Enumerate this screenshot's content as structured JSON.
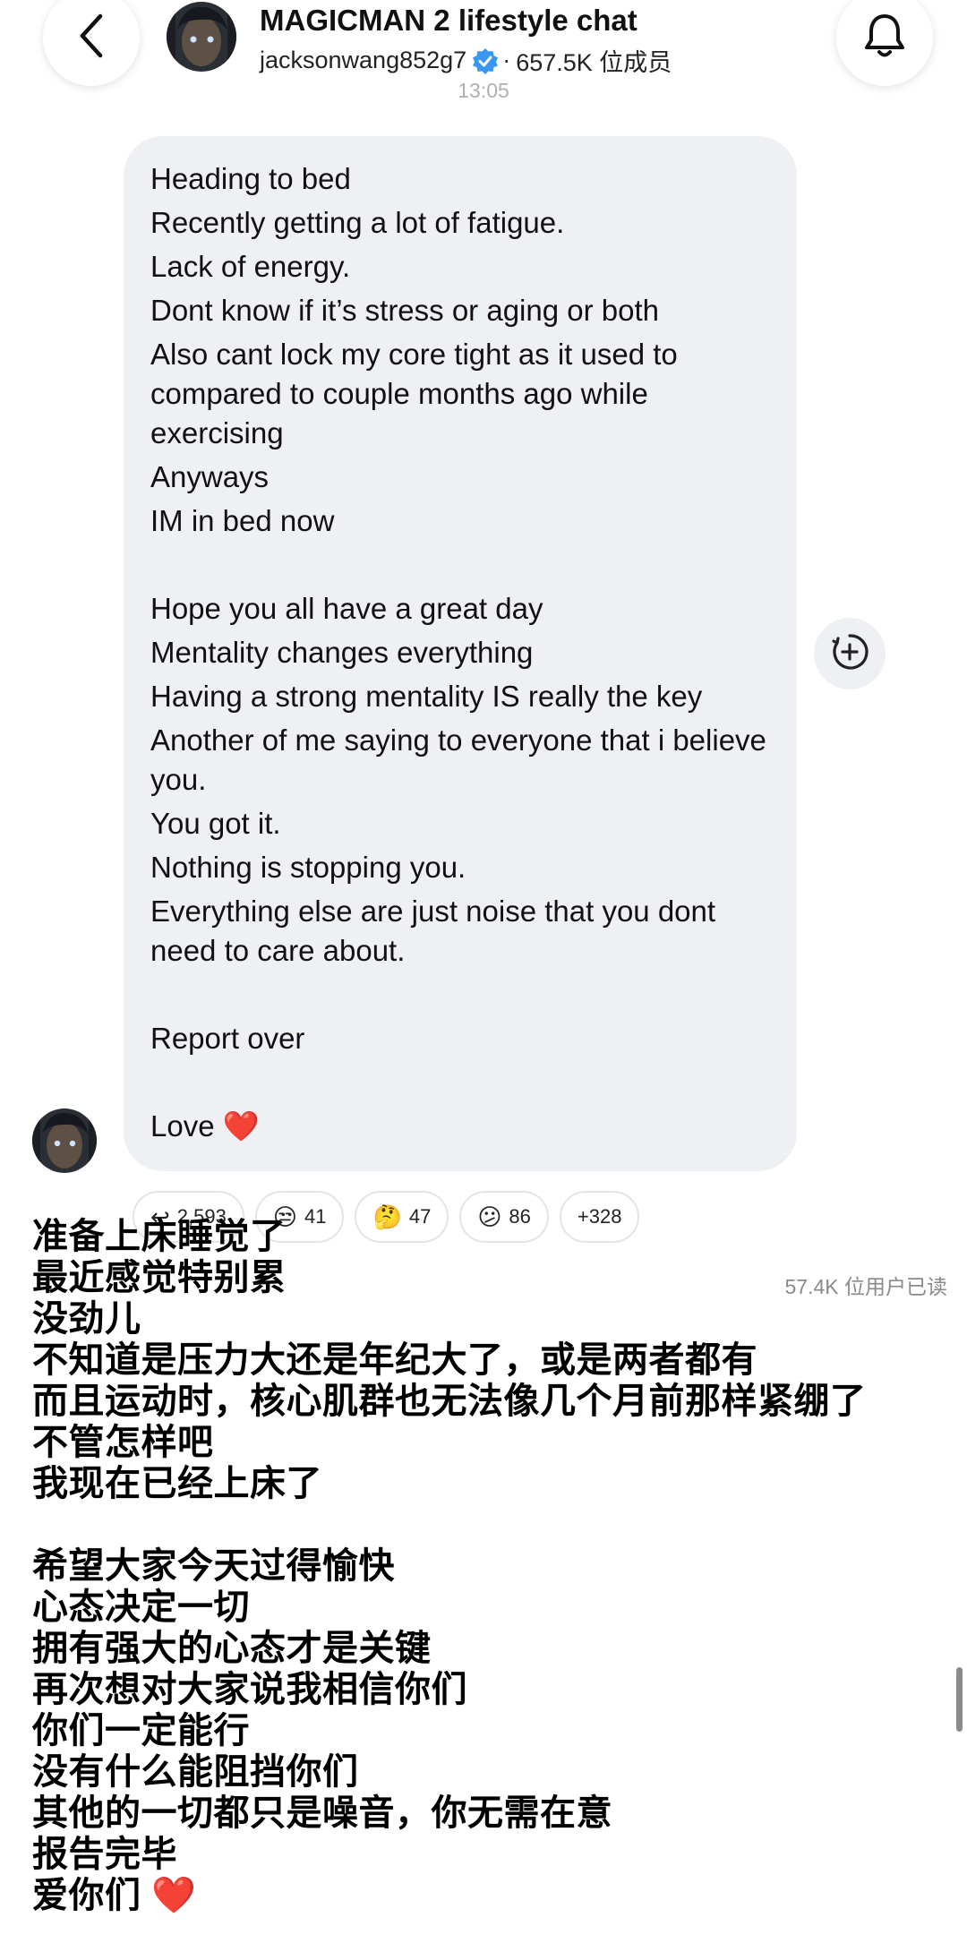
{
  "header": {
    "title": "MAGICMAN 2 lifestyle chat",
    "username": "jacksonwang852g7",
    "separator": "·",
    "members": "657.5K 位成员",
    "timestamp": "13:05"
  },
  "message": {
    "lines": [
      "Heading to bed",
      "Recently getting a lot of fatigue.",
      "Lack of energy.",
      "Dont know if it’s stress or aging or both",
      "Also cant lock my core tight as it used to compared to couple months ago while exercising",
      "Anyways",
      "IM in bed now",
      "",
      "Hope you all have a great day",
      "Mentality changes everything",
      "Having a strong mentality IS really the key",
      "Another of me saying to everyone that i believe you.",
      "You got it.",
      "Nothing is stopping you.",
      "Everything else are just noise that you dont need to care about.",
      "",
      "Report over",
      "",
      "Love ❤️"
    ]
  },
  "reactions": [
    {
      "icon": "reply-icon",
      "emoji": "↩",
      "count": "2,593"
    },
    {
      "icon": "unamused-face-icon",
      "emoji": "😒",
      "count": "41"
    },
    {
      "icon": "thinking-face-icon",
      "emoji": "🤔",
      "count": "47"
    },
    {
      "icon": "confused-face-icon",
      "emoji": "😕",
      "count": "86"
    },
    {
      "icon": "more-reactions",
      "emoji": "",
      "count": "+328"
    }
  ],
  "read_count": "57.4K 位用户已读",
  "translation": {
    "lines": [
      "准备上床睡觉了",
      "最近感觉特别累",
      "没劲儿",
      "不知道是压力大还是年纪大了，或是两者都有",
      "而且运动时，核心肌群也无法像几个月前那样紧绷了",
      "不管怎样吧",
      "我现在已经上床了",
      "",
      "希望大家今天过得愉快",
      "心态决定一切",
      "拥有强大的心态才是关键",
      "再次想对大家说我相信你们",
      "你们一定能行",
      "没有什么能阻挡你们",
      "其他的一切都只是噪音，你无需在意",
      "报告完毕",
      "爱你们 ❤️"
    ]
  },
  "colors": {
    "bubble_bg": "#eef0f3",
    "verified_blue": "#3897f0",
    "heart_red": "#e0202a",
    "muted_text": "#8a8a8a"
  }
}
